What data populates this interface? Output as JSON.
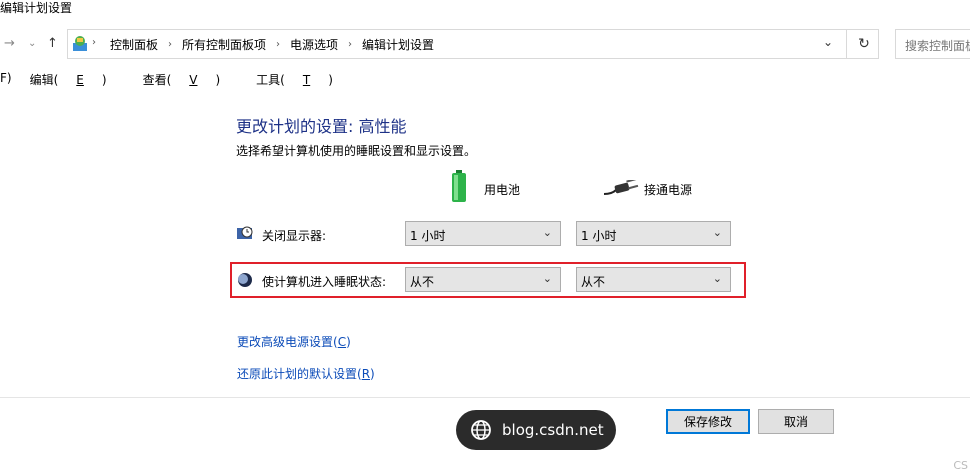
{
  "window": {
    "title": "编辑计划设置"
  },
  "address": {
    "crumbs": [
      "控制面板",
      "所有控制面板项",
      "电源选项",
      "编辑计划设置"
    ],
    "search_placeholder": "搜索控制面板"
  },
  "menu": {
    "file_fragment": "F)",
    "edit": "编辑(",
    "edit_key": "E",
    "view": "查看(",
    "view_key": "V",
    "tools": "工具(",
    "tools_key": "T",
    "close_paren": ")"
  },
  "plan": {
    "heading": "更改计划的设置: 高性能",
    "subtitle": "选择希望计算机使用的睡眠设置和显示设置。"
  },
  "columns": {
    "battery": "用电池",
    "plugged": "接通电源"
  },
  "settings": [
    {
      "label": "关闭显示器:",
      "battery_value": "1 小时",
      "plugged_value": "1 小时"
    },
    {
      "label": "使计算机进入睡眠状态:",
      "battery_value": "从不",
      "plugged_value": "从不"
    }
  ],
  "links": {
    "advanced": "更改高级电源设置(",
    "advanced_key": "C",
    "restore": "还原此计划的默认设置(",
    "restore_key": "R",
    "close_paren": ")"
  },
  "buttons": {
    "save": "保存修改",
    "cancel": "取消"
  },
  "watermark": {
    "text": "blog.csdn.net",
    "corner": "CS"
  },
  "colors": {
    "heading": "#1e3287",
    "link": "#0b4bb8",
    "highlight": "#e0202a",
    "battery": "#2db34a"
  }
}
